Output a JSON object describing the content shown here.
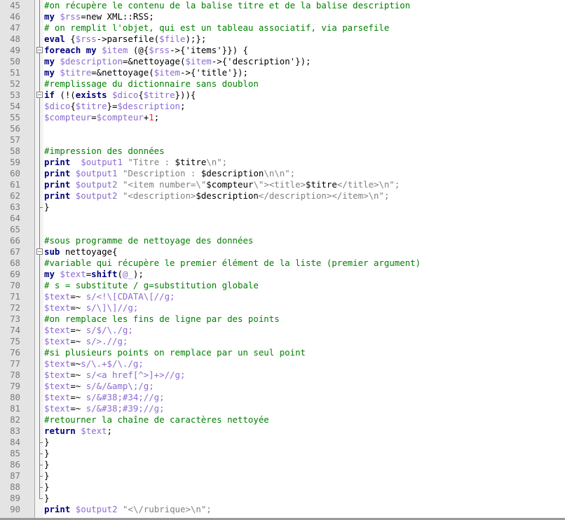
{
  "editor": {
    "language": "Perl",
    "colors": {
      "gutter_bg": "#e4e4e4",
      "comment": "#008000",
      "keyword": "#000080",
      "variable": "#8c6ad2",
      "string": "#808080",
      "number": "#ff2020"
    },
    "lines": [
      {
        "n": "45",
        "fold": "line",
        "tokens": [
          {
            "t": "c",
            "s": "#on récupère le contenu de la balise titre et de la balise description"
          }
        ]
      },
      {
        "n": "46",
        "fold": "line",
        "tokens": [
          {
            "t": "k",
            "s": "my"
          },
          {
            "t": "p",
            "s": " "
          },
          {
            "t": "v",
            "s": "$rss"
          },
          {
            "t": "p",
            "s": "=new XML::RSS;"
          }
        ]
      },
      {
        "n": "47",
        "fold": "line",
        "tokens": [
          {
            "t": "c",
            "s": "# on remplit l'objet, qui est un tableau associatif, via parsefile"
          }
        ]
      },
      {
        "n": "48",
        "fold": "line",
        "tokens": [
          {
            "t": "k",
            "s": "eval"
          },
          {
            "t": "p",
            "s": " {"
          },
          {
            "t": "v",
            "s": "$rss"
          },
          {
            "t": "p",
            "s": "->parsefile("
          },
          {
            "t": "v",
            "s": "$file"
          },
          {
            "t": "p",
            "s": ");};"
          }
        ]
      },
      {
        "n": "49",
        "fold": "open",
        "tokens": [
          {
            "t": "k",
            "s": "foreach my"
          },
          {
            "t": "p",
            "s": " "
          },
          {
            "t": "v",
            "s": "$item"
          },
          {
            "t": "p",
            "s": " (@{"
          },
          {
            "t": "v",
            "s": "$rss"
          },
          {
            "t": "p",
            "s": "->{'items'}}) {"
          }
        ]
      },
      {
        "n": "50",
        "fold": "line",
        "tokens": [
          {
            "t": "k",
            "s": "my"
          },
          {
            "t": "p",
            "s": " "
          },
          {
            "t": "v",
            "s": "$description"
          },
          {
            "t": "p",
            "s": "=&nettoyage("
          },
          {
            "t": "v",
            "s": "$item"
          },
          {
            "t": "p",
            "s": "->{'description'});"
          }
        ]
      },
      {
        "n": "51",
        "fold": "line",
        "tokens": [
          {
            "t": "k",
            "s": "my"
          },
          {
            "t": "p",
            "s": " "
          },
          {
            "t": "v",
            "s": "$titre"
          },
          {
            "t": "p",
            "s": "=&nettoyage("
          },
          {
            "t": "v",
            "s": "$item"
          },
          {
            "t": "p",
            "s": "->{'title'});"
          }
        ]
      },
      {
        "n": "52",
        "fold": "line",
        "tokens": [
          {
            "t": "c",
            "s": "#remplissage du dictionnaire sans doublon"
          }
        ]
      },
      {
        "n": "53",
        "fold": "open",
        "tokens": [
          {
            "t": "k",
            "s": "if"
          },
          {
            "t": "p",
            "s": " (!("
          },
          {
            "t": "k",
            "s": "exists"
          },
          {
            "t": "p",
            "s": " "
          },
          {
            "t": "v",
            "s": "$dico"
          },
          {
            "t": "p",
            "s": "{"
          },
          {
            "t": "v",
            "s": "$titre"
          },
          {
            "t": "p",
            "s": "})){"
          }
        ]
      },
      {
        "n": "54",
        "fold": "line",
        "tokens": [
          {
            "t": "v",
            "s": "$dico"
          },
          {
            "t": "p",
            "s": "{"
          },
          {
            "t": "v",
            "s": "$titre"
          },
          {
            "t": "p",
            "s": "}="
          },
          {
            "t": "v",
            "s": "$description"
          },
          {
            "t": "p",
            "s": ";"
          }
        ]
      },
      {
        "n": "55",
        "fold": "line",
        "tokens": [
          {
            "t": "v",
            "s": "$compteur"
          },
          {
            "t": "p",
            "s": "="
          },
          {
            "t": "v",
            "s": "$compteur"
          },
          {
            "t": "p",
            "s": "+"
          },
          {
            "t": "n",
            "s": "1"
          },
          {
            "t": "p",
            "s": ";"
          }
        ]
      },
      {
        "n": "56",
        "fold": "line",
        "tokens": []
      },
      {
        "n": "57",
        "fold": "line",
        "tokens": []
      },
      {
        "n": "58",
        "fold": "line",
        "tokens": [
          {
            "t": "c",
            "s": "#impression des données"
          }
        ]
      },
      {
        "n": "59",
        "fold": "line",
        "tokens": [
          {
            "t": "k",
            "s": "print"
          },
          {
            "t": "p",
            "s": "  "
          },
          {
            "t": "v",
            "s": "$output1"
          },
          {
            "t": "p",
            "s": " "
          },
          {
            "t": "s",
            "s": "\"Titre : "
          },
          {
            "t": "p",
            "s": "$titre"
          },
          {
            "t": "s",
            "s": "\\n\";"
          }
        ]
      },
      {
        "n": "60",
        "fold": "line",
        "tokens": [
          {
            "t": "k",
            "s": "print"
          },
          {
            "t": "p",
            "s": " "
          },
          {
            "t": "v",
            "s": "$output1"
          },
          {
            "t": "p",
            "s": " "
          },
          {
            "t": "s",
            "s": "\"Description : "
          },
          {
            "t": "p",
            "s": "$description"
          },
          {
            "t": "s",
            "s": "\\n\\n\";"
          }
        ]
      },
      {
        "n": "61",
        "fold": "line",
        "tokens": [
          {
            "t": "k",
            "s": "print"
          },
          {
            "t": "p",
            "s": " "
          },
          {
            "t": "v",
            "s": "$output2"
          },
          {
            "t": "p",
            "s": " "
          },
          {
            "t": "s",
            "s": "\"<item number=\\\""
          },
          {
            "t": "p",
            "s": "$compteur"
          },
          {
            "t": "s",
            "s": "\\\"><title>"
          },
          {
            "t": "p",
            "s": "$titre"
          },
          {
            "t": "s",
            "s": "</title>\\n\";"
          }
        ]
      },
      {
        "n": "62",
        "fold": "line",
        "tokens": [
          {
            "t": "k",
            "s": "print"
          },
          {
            "t": "p",
            "s": " "
          },
          {
            "t": "v",
            "s": "$output2"
          },
          {
            "t": "p",
            "s": " "
          },
          {
            "t": "s",
            "s": "\"<description>"
          },
          {
            "t": "p",
            "s": "$description"
          },
          {
            "t": "s",
            "s": "</description></item>\\n\";"
          }
        ]
      },
      {
        "n": "63",
        "fold": "end",
        "tokens": [
          {
            "t": "p",
            "s": "}"
          }
        ]
      },
      {
        "n": "64",
        "fold": "line",
        "tokens": []
      },
      {
        "n": "65",
        "fold": "line",
        "tokens": []
      },
      {
        "n": "66",
        "fold": "line",
        "tokens": [
          {
            "t": "c",
            "s": "#sous programme de nettoyage des données"
          }
        ]
      },
      {
        "n": "67",
        "fold": "open",
        "tokens": [
          {
            "t": "k",
            "s": "sub"
          },
          {
            "t": "p",
            "s": " nettoyage{"
          }
        ]
      },
      {
        "n": "68",
        "fold": "line",
        "tokens": [
          {
            "t": "c",
            "s": "#variable qui récupère le premier élément de la liste (premier argument)"
          }
        ]
      },
      {
        "n": "69",
        "fold": "line",
        "tokens": [
          {
            "t": "k",
            "s": "my"
          },
          {
            "t": "p",
            "s": " "
          },
          {
            "t": "v",
            "s": "$text"
          },
          {
            "t": "p",
            "s": "="
          },
          {
            "t": "k",
            "s": "shift"
          },
          {
            "t": "p",
            "s": "("
          },
          {
            "t": "v",
            "s": "@_"
          },
          {
            "t": "p",
            "s": ");"
          }
        ]
      },
      {
        "n": "70",
        "fold": "line",
        "tokens": [
          {
            "t": "c",
            "s": "# s = substitute / g=substitution globale"
          }
        ]
      },
      {
        "n": "71",
        "fold": "line",
        "tokens": [
          {
            "t": "v",
            "s": "$text"
          },
          {
            "t": "p",
            "s": "=~ "
          },
          {
            "t": "v",
            "s": "s/<!\\[CDATA\\[//g;"
          }
        ]
      },
      {
        "n": "72",
        "fold": "line",
        "tokens": [
          {
            "t": "v",
            "s": "$text"
          },
          {
            "t": "p",
            "s": "=~ "
          },
          {
            "t": "v",
            "s": "s/\\]\\]//g;"
          }
        ]
      },
      {
        "n": "73",
        "fold": "line",
        "tokens": [
          {
            "t": "c",
            "s": "#on remplace les fins de ligne par des points"
          }
        ]
      },
      {
        "n": "74",
        "fold": "line",
        "tokens": [
          {
            "t": "v",
            "s": "$text"
          },
          {
            "t": "p",
            "s": "=~ "
          },
          {
            "t": "v",
            "s": "s/$/\\./g;"
          }
        ]
      },
      {
        "n": "75",
        "fold": "line",
        "tokens": [
          {
            "t": "v",
            "s": "$text"
          },
          {
            "t": "p",
            "s": "=~ "
          },
          {
            "t": "v",
            "s": "s/>.//g;"
          }
        ]
      },
      {
        "n": "76",
        "fold": "line",
        "tokens": [
          {
            "t": "c",
            "s": "#si plusieurs points on remplace par un seul point"
          }
        ]
      },
      {
        "n": "77",
        "fold": "line",
        "tokens": [
          {
            "t": "v",
            "s": "$text"
          },
          {
            "t": "p",
            "s": "=~"
          },
          {
            "t": "v",
            "s": "s/\\.+$/\\./g;"
          }
        ]
      },
      {
        "n": "78",
        "fold": "line",
        "tokens": [
          {
            "t": "v",
            "s": "$text"
          },
          {
            "t": "p",
            "s": "=~ "
          },
          {
            "t": "v",
            "s": "s/<a href[^>]+>//g;"
          }
        ]
      },
      {
        "n": "79",
        "fold": "line",
        "tokens": [
          {
            "t": "v",
            "s": "$text"
          },
          {
            "t": "p",
            "s": "=~ "
          },
          {
            "t": "v",
            "s": "s/&/&amp\\;/g;"
          }
        ]
      },
      {
        "n": "80",
        "fold": "line",
        "tokens": [
          {
            "t": "v",
            "s": "$text"
          },
          {
            "t": "p",
            "s": "=~ "
          },
          {
            "t": "v",
            "s": "s/&#38;#34;//g;"
          }
        ]
      },
      {
        "n": "81",
        "fold": "line",
        "tokens": [
          {
            "t": "v",
            "s": "$text"
          },
          {
            "t": "p",
            "s": "=~ "
          },
          {
            "t": "v",
            "s": "s/&#38;#39;//g;"
          }
        ]
      },
      {
        "n": "82",
        "fold": "line",
        "tokens": [
          {
            "t": "c",
            "s": "#retourner la chaîne de caractères nettoyée"
          }
        ]
      },
      {
        "n": "83",
        "fold": "line",
        "tokens": [
          {
            "t": "k",
            "s": "return"
          },
          {
            "t": "p",
            "s": " "
          },
          {
            "t": "v",
            "s": "$text"
          },
          {
            "t": "p",
            "s": ";"
          }
        ]
      },
      {
        "n": "84",
        "fold": "end",
        "tokens": [
          {
            "t": "p",
            "s": "}"
          }
        ]
      },
      {
        "n": "85",
        "fold": "end",
        "tokens": [
          {
            "t": "p",
            "s": "}"
          }
        ]
      },
      {
        "n": "86",
        "fold": "end",
        "tokens": [
          {
            "t": "p",
            "s": "}"
          }
        ]
      },
      {
        "n": "87",
        "fold": "end",
        "tokens": [
          {
            "t": "p",
            "s": "}"
          }
        ]
      },
      {
        "n": "88",
        "fold": "end",
        "tokens": [
          {
            "t": "p",
            "s": "}"
          }
        ]
      },
      {
        "n": "89",
        "fold": "last",
        "tokens": [
          {
            "t": "p",
            "s": "}"
          }
        ]
      },
      {
        "n": "90",
        "fold": "none",
        "tokens": [
          {
            "t": "k",
            "s": "print"
          },
          {
            "t": "p",
            "s": " "
          },
          {
            "t": "v",
            "s": "$output2"
          },
          {
            "t": "p",
            "s": " "
          },
          {
            "t": "s",
            "s": "\"<\\/rubrique>\\n\";"
          }
        ]
      }
    ]
  }
}
